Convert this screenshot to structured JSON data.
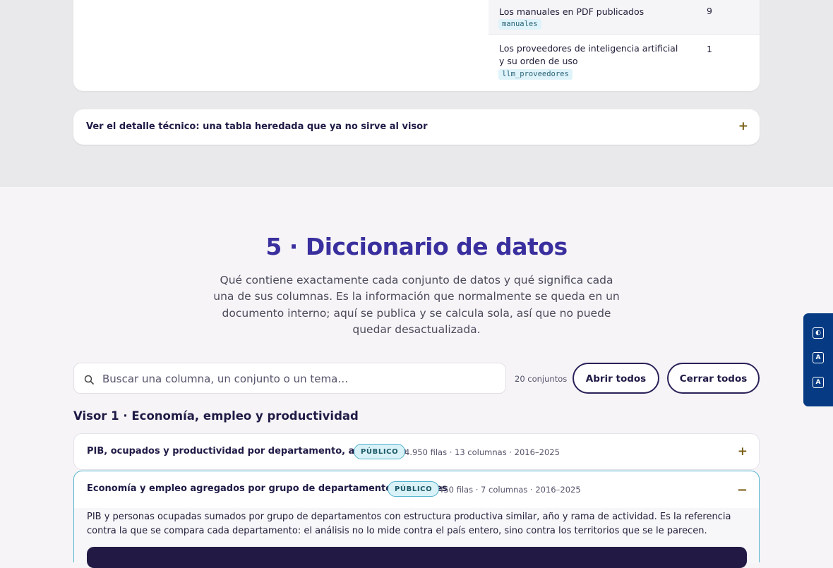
{
  "top_table": {
    "rows": [
      {
        "description": "Los manuales en PDF publicados",
        "code": "manuales",
        "count": "9"
      },
      {
        "description": "Los proveedores de inteligencia artificial y su orden de uso",
        "code": "llm_proveedores",
        "count": "1"
      }
    ]
  },
  "technical_detail": {
    "label": "Ver el detalle técnico: una tabla heredada que ya no sirve al visor",
    "toggle": "+"
  },
  "section": {
    "title": "5 · Diccionario de datos",
    "description": "Qué contiene exactamente cada conjunto de datos y qué significa cada una de sus columnas. Es la información que normalmente se queda en un documento interno; aquí se publica y se calcula sola, así que no puede quedar desactualizada."
  },
  "search": {
    "placeholder": "Buscar una columna, un conjunto o un tema…",
    "icon": "search-icon"
  },
  "toolbar": {
    "count": "20 conjuntos",
    "open_all": "Abrir todos",
    "close_all": "Cerrar todos"
  },
  "group": {
    "title": "Visor 1 · Economía, empleo y productividad"
  },
  "datasets": [
    {
      "title": "PIB, ocupados y productividad por departamento, año y rama",
      "badge": "PÚBLICO",
      "meta": "4.950 filas · 13 columnas · 2016–2025",
      "toggle": "+"
    },
    {
      "title": "Economía y empleo agregados por grupo de departamentos similares",
      "badge": "PÚBLICO",
      "meta": "450 filas · 7 columnas · 2016–2025",
      "toggle": "−",
      "description": "PIB y personas ocupadas sumados por grupo de departamentos con estructura productiva similar, año y rama de actividad. Es la referencia contra la que se compara cada departamento: el análisis no lo mide contra el país entero, sino contra los territorios que se le parecen."
    }
  ],
  "accessibility": {
    "buttons": [
      {
        "icon": "contrast-icon",
        "glyph": "◐"
      },
      {
        "icon": "text-increase-icon",
        "glyph": "A"
      },
      {
        "icon": "text-decrease-icon",
        "glyph": "A"
      }
    ]
  },
  "colors": {
    "brand": "#3a2f9e",
    "accent_border": "#56b5cf",
    "badge_bg": "#d9f2f8",
    "toggle": "#7a5f16",
    "a11y_panel": "#063b83"
  }
}
